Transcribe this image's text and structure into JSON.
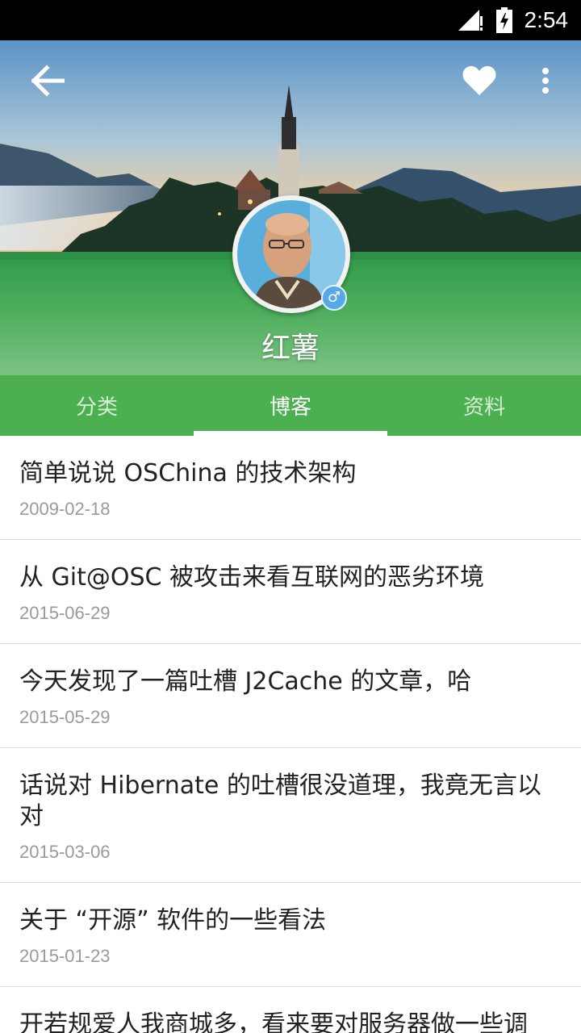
{
  "status_bar": {
    "time": "2:54",
    "icons": [
      "signal-icon",
      "battery-icon"
    ]
  },
  "toolbar": {
    "back_icon": "arrow-left-icon",
    "favorite_icon": "heart-icon",
    "more_icon": "more-vertical-icon"
  },
  "profile": {
    "name": "红薯",
    "gender_symbol": "♂"
  },
  "tabs": [
    {
      "label": "分类",
      "active": false
    },
    {
      "label": "博客",
      "active": true
    },
    {
      "label": "资料",
      "active": false
    }
  ],
  "blogs": [
    {
      "title": "简单说说 OSChina 的技术架构",
      "date": "2009-02-18"
    },
    {
      "title": "从 Git@OSC 被攻击来看互联网的恶劣环境",
      "date": "2015-06-29"
    },
    {
      "title": "今天发现了一篇吐槽 J2Cache 的文章，哈",
      "date": "2015-05-29"
    },
    {
      "title": "话说对 Hibernate 的吐槽很没道理，我竟无言以对",
      "date": "2015-03-06"
    },
    {
      "title": "关于 “开源” 软件的一些看法",
      "date": "2015-01-23"
    },
    {
      "title": "开若规爱人我商城多，看来要对服务器做一些调",
      "date": ""
    }
  ],
  "colors": {
    "accent": "#4caf50",
    "status_bar": "#000000",
    "badge": "#56a9e8"
  }
}
